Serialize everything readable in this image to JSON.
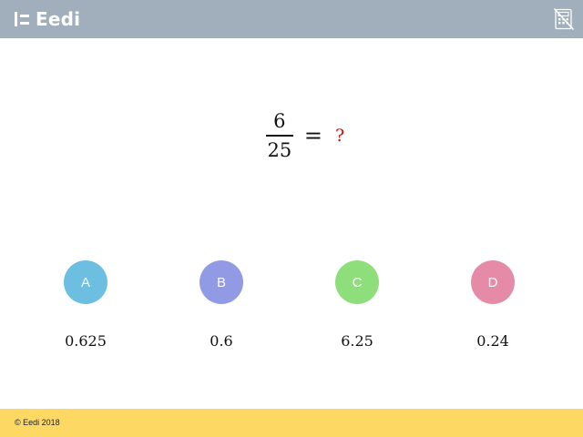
{
  "header": {
    "brand": "Eedi",
    "background": "#a1afbd",
    "calculator_icon": "calculator-disabled-icon"
  },
  "question": {
    "numerator": "6",
    "denominator": "25",
    "equals": "=",
    "unknown": "?"
  },
  "options": [
    {
      "letter": "A",
      "answer": "0.625",
      "color": "#6cbfe0"
    },
    {
      "letter": "B",
      "answer": "0.6",
      "color": "#919be5"
    },
    {
      "letter": "C",
      "answer": "6.25",
      "color": "#8ede7c"
    },
    {
      "letter": "D",
      "answer": "0.24",
      "color": "#e58ba8"
    }
  ],
  "footer": {
    "copyright": "© Eedi 2018",
    "background": "#fdd963"
  }
}
